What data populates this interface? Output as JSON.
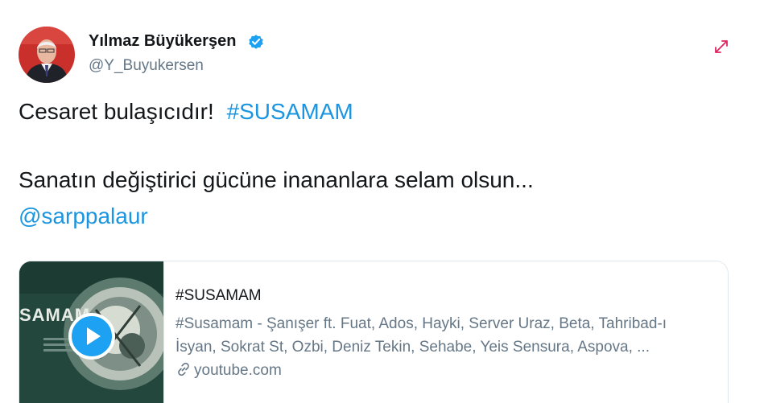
{
  "tweet": {
    "author_name": "Yılmaz Büyükerşen",
    "author_handle": "@Y_Buyukersen",
    "text_line1": "Cesaret bulaşıcıdır!",
    "hashtag": "#SUSAMAM",
    "text_line2": "Sanatın değiştirici gücüne inananlara selam olsun...",
    "mention": "@sarppalaur"
  },
  "card": {
    "title": "#SUSAMAM",
    "description_line1": "#Susamam - Şanışer ft. Fuat, Ados, Hayki, Server Uraz, Beta, Tahribad-ı",
    "description_line2": "İsyan, Sokrat St, Ozbi, Deniz Tekin, Sehabe, Yeis Sensura, Aspova, ...",
    "domain": "youtube.com",
    "thumbnail_text": "SAMAM"
  },
  "colors": {
    "link": "#1b95e0",
    "verified": "#1da1f2",
    "secondary_text": "#657786",
    "more_icon": "#e0245e"
  },
  "icons": {
    "verified": "verified-badge-icon",
    "more": "caret-more-icon",
    "play": "play-icon",
    "link": "link-icon"
  }
}
